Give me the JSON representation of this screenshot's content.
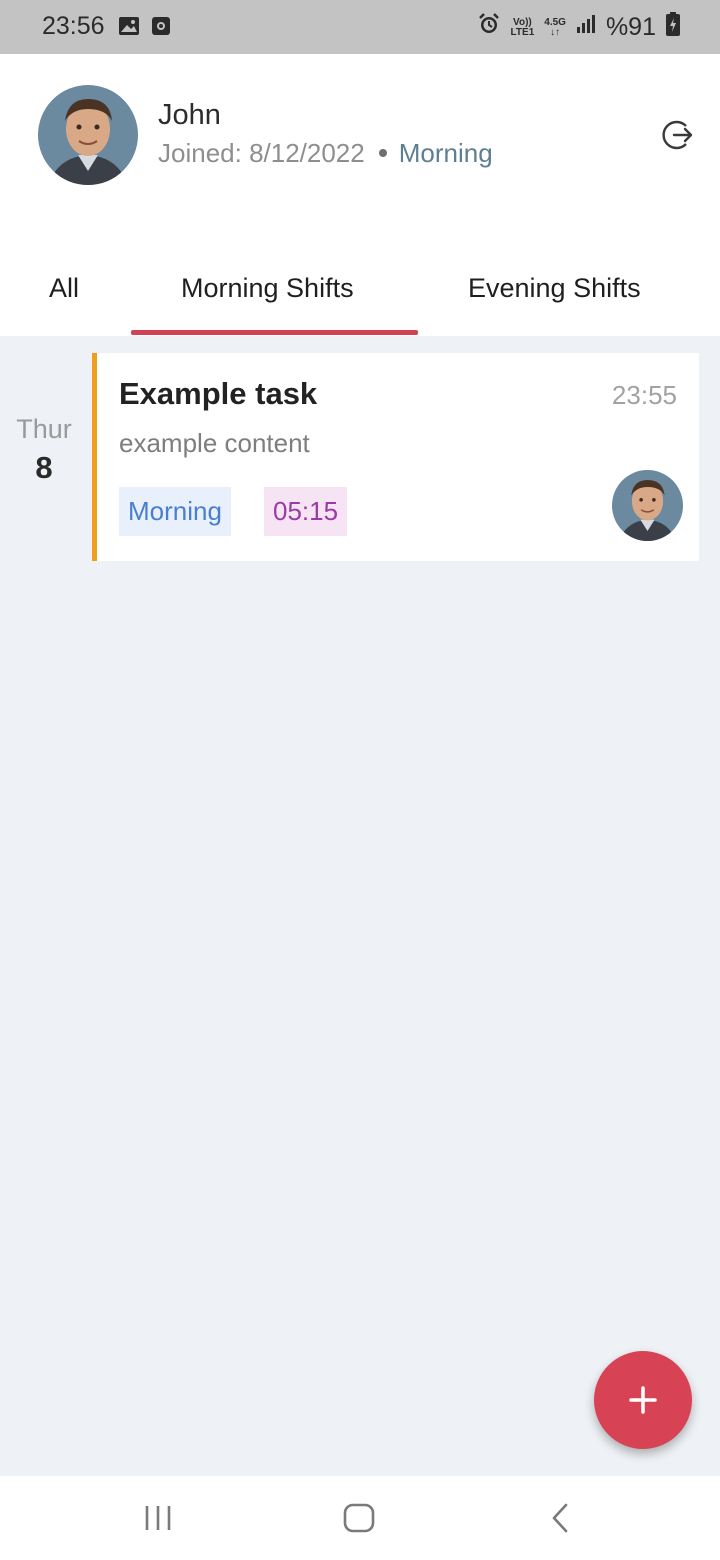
{
  "status_bar": {
    "time": "23:56",
    "volte_label": "Vo))",
    "lte_label": "LTE1",
    "network_label": "4.5G",
    "battery_text": "%91",
    "icons": [
      "image-icon",
      "notification-icon",
      "alarm-icon",
      "signal-icon",
      "battery-icon"
    ]
  },
  "profile": {
    "name": "John",
    "joined_label": "Joined: 8/12/2022",
    "shift": "Morning"
  },
  "tabs": [
    {
      "label": "All",
      "active": false
    },
    {
      "label": "Morning Shifts",
      "active": true
    },
    {
      "label": "Evening Shifts",
      "active": false
    }
  ],
  "colors": {
    "accent": "#d84255",
    "card_border": "#ef9f20",
    "shift_chip_text": "#4a7ed0",
    "duration_chip_text": "#9b3aa6",
    "background": "#eef1f5"
  },
  "tasks": [
    {
      "day_name": "Thur",
      "day_number": "8",
      "title": "Example task",
      "time": "23:55",
      "content": "example content",
      "shift_chip": "Morning",
      "duration_chip": "05:15"
    }
  ],
  "fab_icon": "plus-icon",
  "nav_icons": [
    "recent-apps-icon",
    "home-icon",
    "back-icon"
  ]
}
